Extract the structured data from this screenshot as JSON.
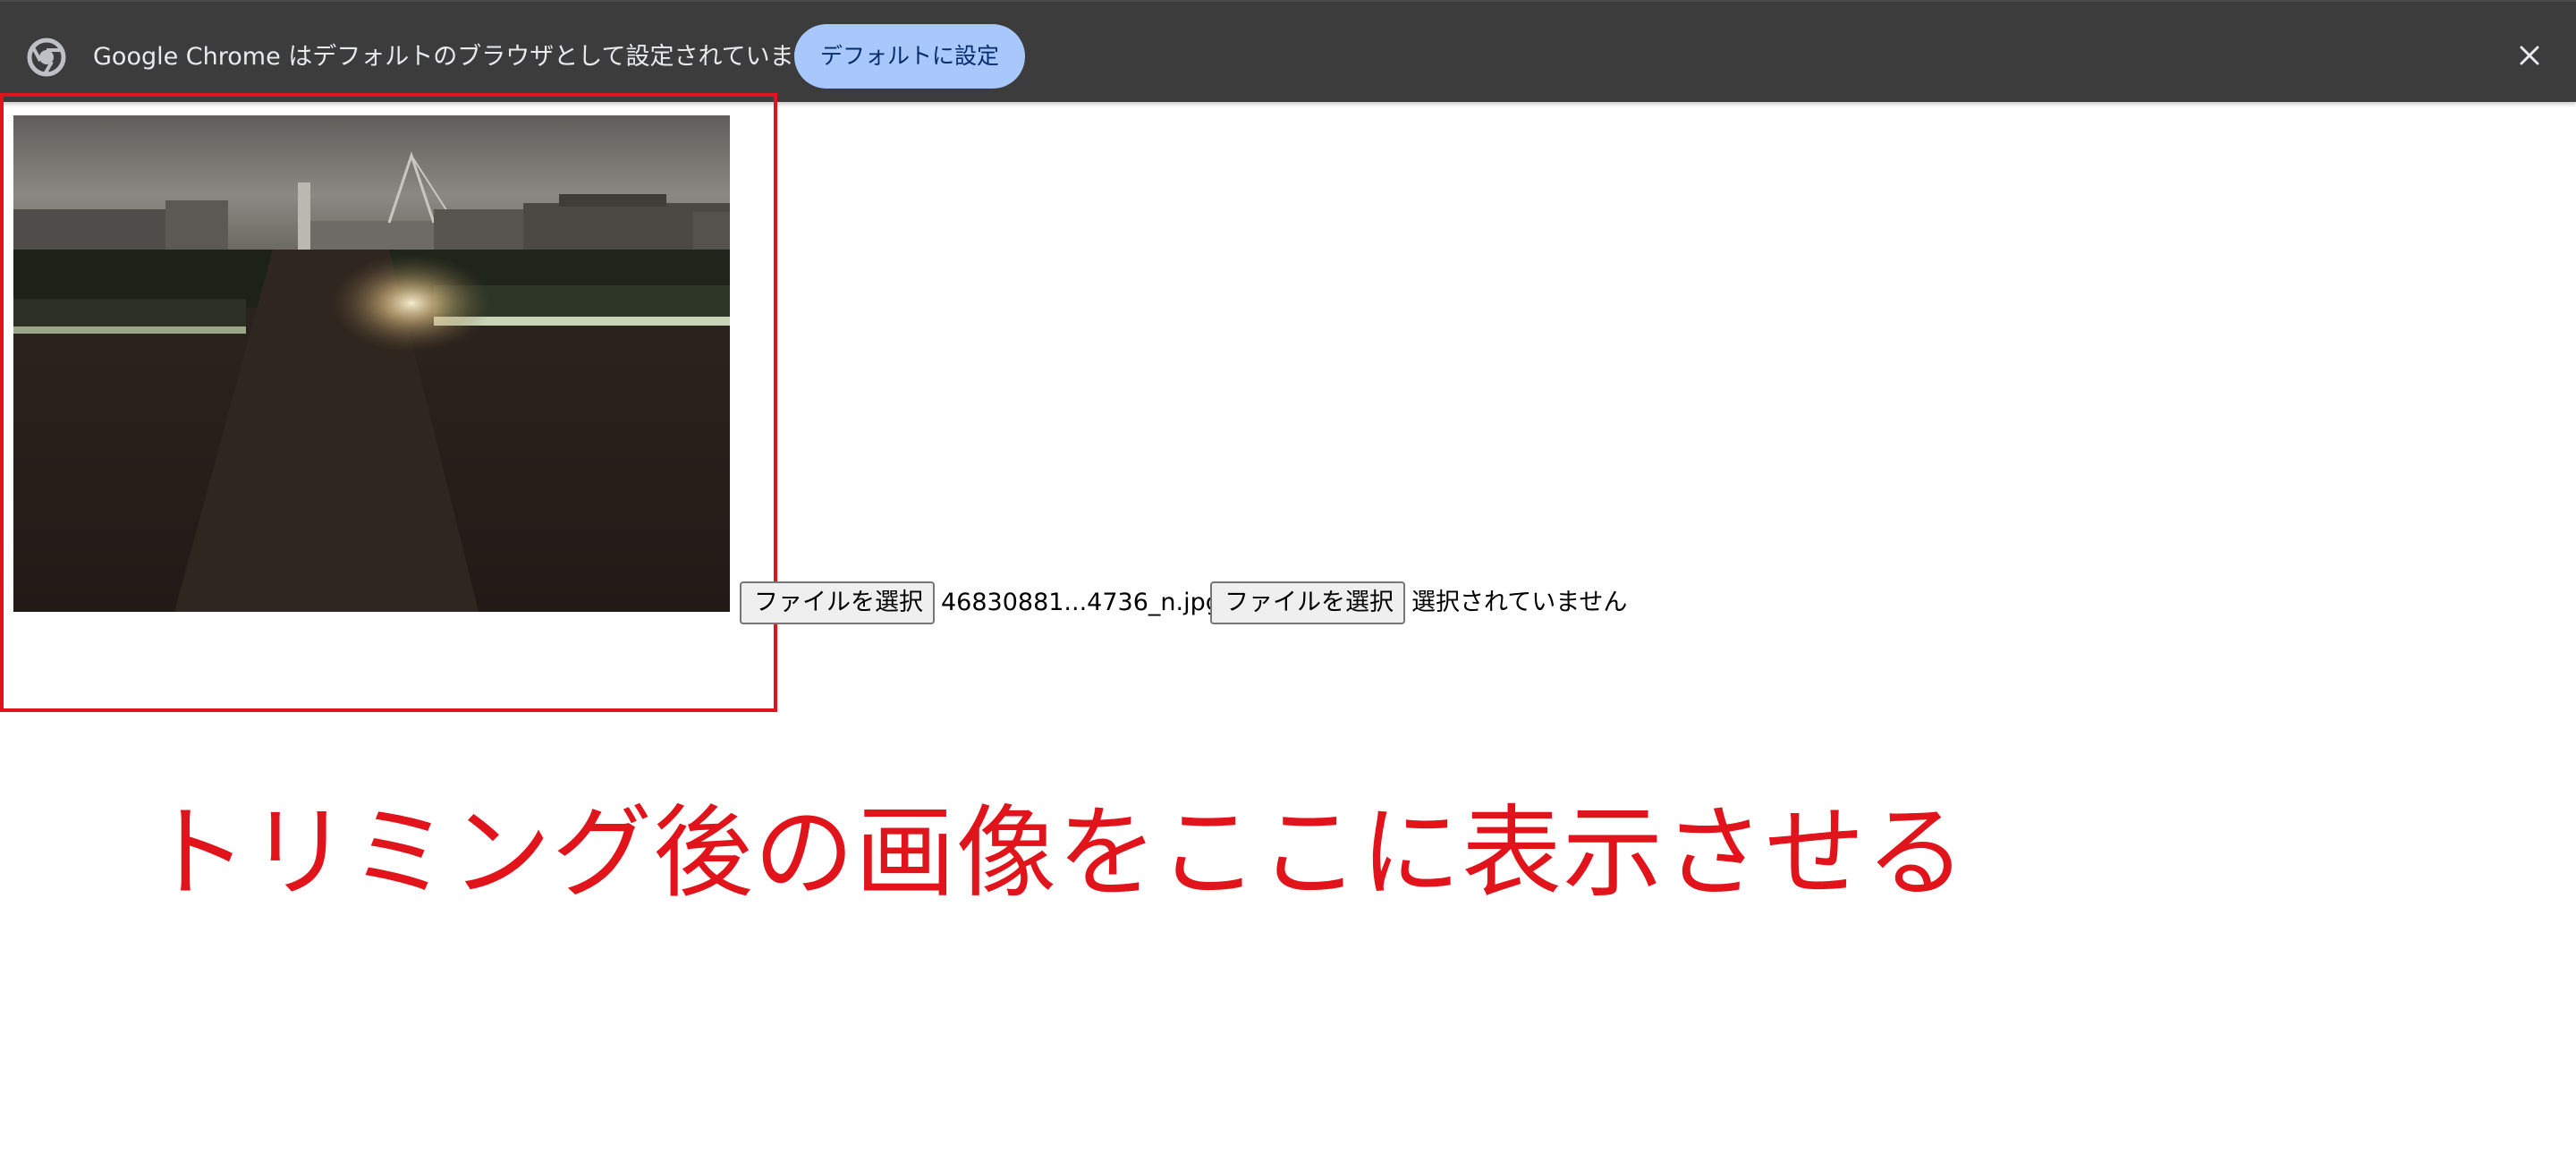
{
  "infobar": {
    "message": "Google Chrome はデフォルトのブラウザとして設定されていません",
    "set_default_label": "デフォルトに設定",
    "logo_icon": "chrome-logo-icon",
    "close_icon": "close-icon"
  },
  "file_inputs": [
    {
      "button_label": "ファイルを選択",
      "filename": "46830881...4736_n.jpg"
    },
    {
      "button_label": "ファイルを選択",
      "filename": "選択されていません"
    }
  ],
  "annotation": {
    "text": "トリミング後の画像をここに表示させる",
    "color": "#e0141a"
  },
  "colors": {
    "infobar_bg": "#3c3c3c",
    "button_accent": "#a8c7fa",
    "annotation_red": "#e0141a"
  }
}
